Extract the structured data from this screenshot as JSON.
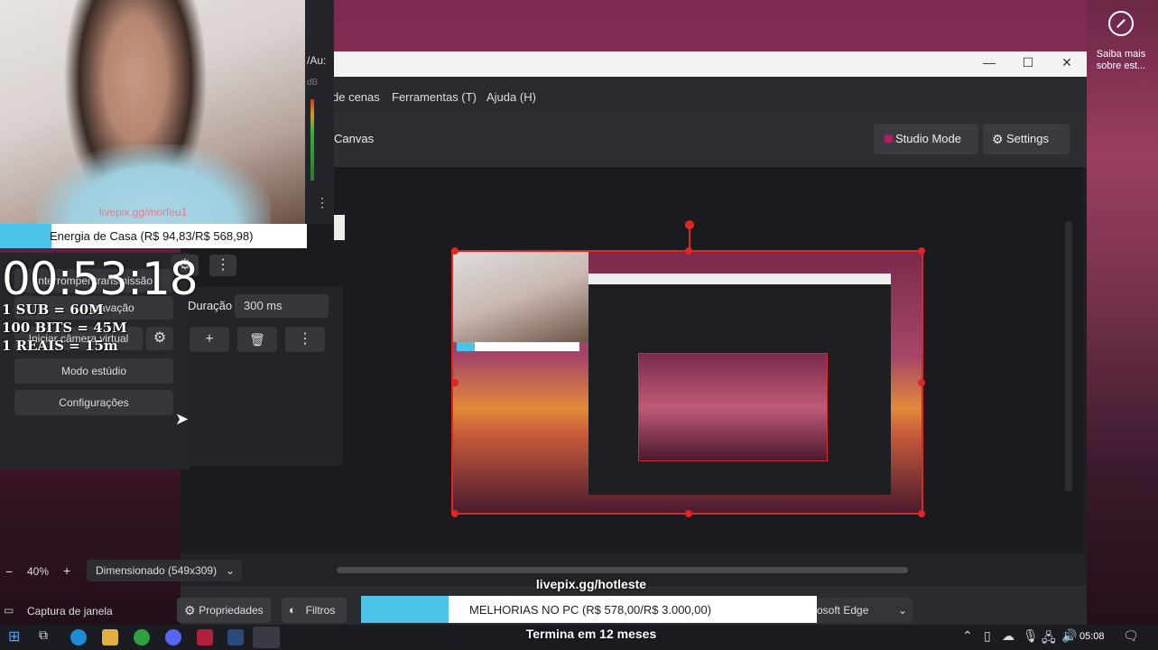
{
  "desktop": {
    "learn_more_line1": "Saiba mais",
    "learn_more_line2": "sobre est..."
  },
  "obs": {
    "window_controls": {
      "minimize": "—",
      "maximize": "☐",
      "close": "✕"
    },
    "menu": {
      "scenes": "de cenas",
      "tools": "Ferramentas (T)",
      "help": "Ajuda (H)"
    },
    "toolbar": {
      "canvas": "Canvas",
      "studio_mode": "Studio Mode",
      "settings": "Settings"
    },
    "controls": {
      "stop_stream": "Interromper transmissão",
      "recording": "gravação",
      "virtual_camera": "Iniciar câmera virtual",
      "studio_mode": "Modo estúdio",
      "settings": "Configurações",
      "duration_label": "Duração",
      "duration_value": "300 ms",
      "add": "+",
      "more": "⋮"
    },
    "zoom": {
      "minus": "−",
      "value": "40%",
      "plus": "+",
      "scale_mode": "Dimensionado (549x309)"
    },
    "source": {
      "name": "Captura de janela",
      "properties": "Propriedades",
      "filters": "Filtros",
      "window_tail": "osoft Edge"
    },
    "audio_strip_text": "/Au:",
    "audio_strip_db": "dB"
  },
  "overlay": {
    "energy": "Energia de Casa (R$ 94,83/R$ 568,98)",
    "energy_progress": 0.1667,
    "timer": "00:53:18",
    "promo": [
      "1 SUB =  60M",
      "100 BITS = 45M",
      "1 REAIS = 15m"
    ],
    "webcam_watermark": "livepix.gg/morfeu1",
    "livepix": "livepix.gg/hotleste",
    "goal": "MELHORIAS NO PC (R$ 578,00/R$ 3.000,00)",
    "goal_progress": 0.1927,
    "subscription": "Termina em 12 meses"
  },
  "taskbar": {
    "clock": "05:08"
  }
}
